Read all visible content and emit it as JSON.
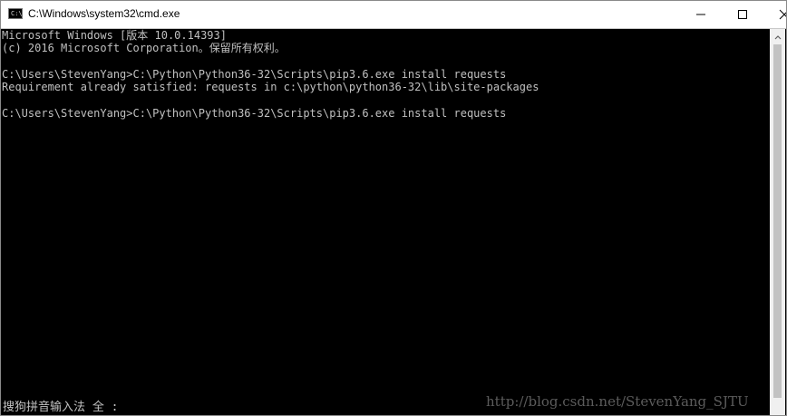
{
  "window": {
    "title": "C:\\Windows\\system32\\cmd.exe",
    "icon": "cmd-icon",
    "controls": {
      "minimize": "minimize-icon",
      "maximize": "maximize-icon",
      "close": "close-icon"
    }
  },
  "console": {
    "background": "#000000",
    "foreground": "#c0c0c0",
    "lines": [
      "Microsoft Windows [版本 10.0.14393]",
      "(c) 2016 Microsoft Corporation。保留所有权利。",
      "",
      "C:\\Users\\StevenYang>C:\\Python\\Python36-32\\Scripts\\pip3.6.exe install requests",
      "Requirement already satisfied: requests in c:\\python\\python36-32\\lib\\site-packages",
      "",
      "C:\\Users\\StevenYang>C:\\Python\\Python36-32\\Scripts\\pip3.6.exe install requests"
    ]
  },
  "ime_status": "搜狗拼音输入法 全 :",
  "watermark": "http://blog.csdn.net/StevenYang_SJTU"
}
